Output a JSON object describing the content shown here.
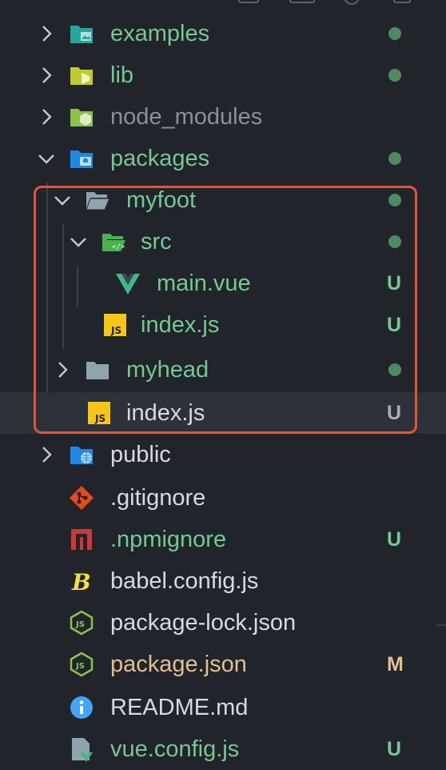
{
  "colors": {
    "background": "#21252b",
    "selected_row": "#2c313a",
    "git_green": "#73c991",
    "git_modified": "#e2c08d",
    "dimmed_text": "#8b8f98",
    "normal_text": "#d7dae0",
    "dot_color": "#4e8a5f",
    "highlight_border": "#e2553c"
  },
  "tree": [
    {
      "name": "examples",
      "kind": "folder",
      "collapsed": true,
      "status": "dot",
      "icon": "examples-folder-icon"
    },
    {
      "name": "lib",
      "kind": "folder",
      "collapsed": true,
      "status": "dot",
      "icon": "lib-folder-icon"
    },
    {
      "name": "node_modules",
      "kind": "folder",
      "collapsed": true,
      "status": "",
      "icon": "node-modules-folder-icon"
    },
    {
      "name": "packages",
      "kind": "folder",
      "collapsed": false,
      "status": "dot",
      "icon": "packages-folder-icon"
    },
    {
      "name": "myfoot",
      "kind": "folder",
      "collapsed": false,
      "status": "dot",
      "icon": "folder-open-icon"
    },
    {
      "name": "src",
      "kind": "folder",
      "collapsed": false,
      "status": "dot",
      "icon": "src-folder-icon"
    },
    {
      "name": "main.vue",
      "kind": "file",
      "status": "U",
      "icon": "vue-icon"
    },
    {
      "name": "index.js",
      "kind": "file",
      "status": "U",
      "icon": "js-icon"
    },
    {
      "name": "myhead",
      "kind": "folder",
      "collapsed": true,
      "status": "dot",
      "icon": "folder-icon"
    },
    {
      "name": "index.js",
      "kind": "file",
      "status": "U",
      "icon": "js-icon"
    },
    {
      "name": "public",
      "kind": "folder",
      "collapsed": true,
      "status": "",
      "icon": "public-folder-icon"
    },
    {
      "name": ".gitignore",
      "kind": "file",
      "status": "",
      "icon": "git-icon"
    },
    {
      "name": ".npmignore",
      "kind": "file",
      "status": "U",
      "icon": "npm-icon"
    },
    {
      "name": "babel.config.js",
      "kind": "file",
      "status": "",
      "icon": "babel-icon"
    },
    {
      "name": "package-lock.json",
      "kind": "file",
      "status": "",
      "icon": "nodejs-icon"
    },
    {
      "name": "package.json",
      "kind": "file",
      "status": "M",
      "icon": "nodejs-icon"
    },
    {
      "name": "README.md",
      "kind": "file",
      "status": "",
      "icon": "info-icon"
    },
    {
      "name": "vue.config.js",
      "kind": "file",
      "status": "U",
      "icon": "vue-config-icon"
    }
  ]
}
